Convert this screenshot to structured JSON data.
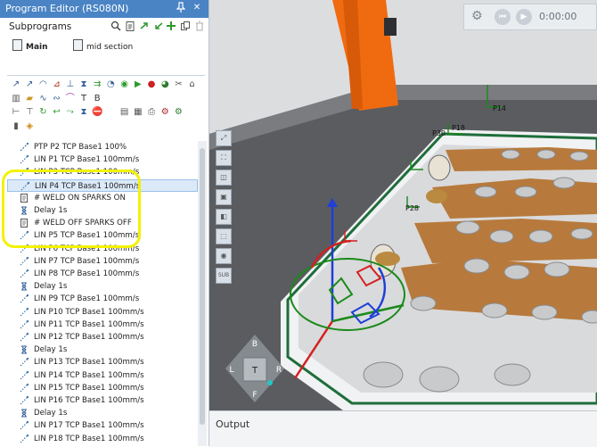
{
  "editor": {
    "title": "Program Editor (RS080N)",
    "pin_icon": "pin-icon",
    "close_icon": "close-icon",
    "subprograms_label": "Subprograms",
    "tabs": [
      "Main",
      "mid section"
    ]
  },
  "program": [
    {
      "icon": "ptp-icon",
      "text": "PTP P2 TCP Base1 100%"
    },
    {
      "icon": "lin-icon",
      "text": "LIN P1 TCP Base1 100mm/s"
    },
    {
      "icon": "lin-icon",
      "text": "LIN P3 TCP Base1 100mm/s"
    },
    {
      "icon": "lin-icon",
      "text": "LIN P4 TCP Base1 100mm/s"
    },
    {
      "icon": "comment-icon",
      "text": "# WELD ON SPARKS ON"
    },
    {
      "icon": "delay-icon",
      "text": "Delay 1s"
    },
    {
      "icon": "comment-icon",
      "text": "# WELD OFF SPARKS OFF"
    },
    {
      "icon": "lin-icon",
      "text": "LIN P5 TCP Base1 100mm/s"
    },
    {
      "icon": "lin-icon",
      "text": "LIN P6 TCP Base1 100mm/s"
    },
    {
      "icon": "lin-icon",
      "text": "LIN P7 TCP Base1 100mm/s"
    },
    {
      "icon": "lin-icon",
      "text": "LIN P8 TCP Base1 100mm/s"
    },
    {
      "icon": "delay-icon",
      "text": "Delay 1s"
    },
    {
      "icon": "lin-icon",
      "text": "LIN P9 TCP Base1 100mm/s"
    },
    {
      "icon": "lin-icon",
      "text": "LIN P10 TCP Base1 100mm/s"
    },
    {
      "icon": "lin-icon",
      "text": "LIN P11 TCP Base1 100mm/s"
    },
    {
      "icon": "lin-icon",
      "text": "LIN P12 TCP Base1 100mm/s"
    },
    {
      "icon": "delay-icon",
      "text": "Delay 1s"
    },
    {
      "icon": "lin-icon",
      "text": "LIN P13 TCP Base1 100mm/s"
    },
    {
      "icon": "lin-icon",
      "text": "LIN P14 TCP Base1 100mm/s"
    },
    {
      "icon": "lin-icon",
      "text": "LIN P15 TCP Base1 100mm/s"
    },
    {
      "icon": "lin-icon",
      "text": "LIN P16 TCP Base1 100mm/s"
    },
    {
      "icon": "delay-icon",
      "text": "Delay 1s"
    },
    {
      "icon": "lin-icon",
      "text": "LIN P17 TCP Base1 100mm/s"
    },
    {
      "icon": "lin-icon",
      "text": "LIN P18 TCP Base1 100mm/s"
    }
  ],
  "selected_index": 3,
  "viewport": {
    "time": "0:00:00",
    "labels": {
      "p14": "P14",
      "p28": "P28",
      "p18": "P18",
      "p30": "P30"
    },
    "navcube": {
      "top": "B",
      "left": "L",
      "center": "T",
      "right": "R",
      "bottom": "F"
    },
    "sidebar_sub": "SUB"
  },
  "output_label": "Output",
  "colors": {
    "title_blue": "#4a84c4",
    "highlight_yellow": "#f2f200",
    "robot_orange": "#f06a10",
    "copper": "#b77a3c"
  }
}
